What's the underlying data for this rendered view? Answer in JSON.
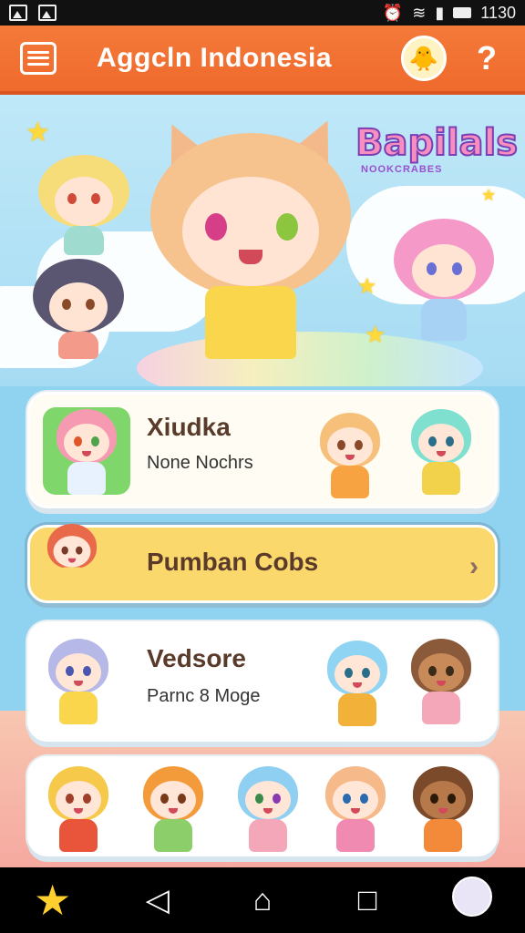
{
  "status_bar": {
    "time": "1130"
  },
  "app_bar": {
    "title": "Aggcln Indonesia",
    "help_label": "?"
  },
  "hero": {
    "logo_title": "Bapilals",
    "logo_subtitle": "NOOKCRABES"
  },
  "cards": [
    {
      "title": "Xiudka",
      "subtitle": "None Nochrs"
    },
    {
      "title": "Pumban Cobs",
      "chevron": "›"
    },
    {
      "title": "Vedsore",
      "subtitle": "Parnc 8 Moge"
    },
    {
      "title": ""
    }
  ],
  "nav": {
    "back": "◁",
    "home": "⌂",
    "recents": "□"
  },
  "colors": {
    "accent": "#f47a3a",
    "highlight": "#fbd86b",
    "sky": "#a6dcf3"
  },
  "icons": [
    "menu-icon",
    "mascot-avatar-icon",
    "help-icon",
    "home-star-icon",
    "back-icon",
    "home-icon",
    "recents-icon",
    "profile-avatar-icon"
  ]
}
